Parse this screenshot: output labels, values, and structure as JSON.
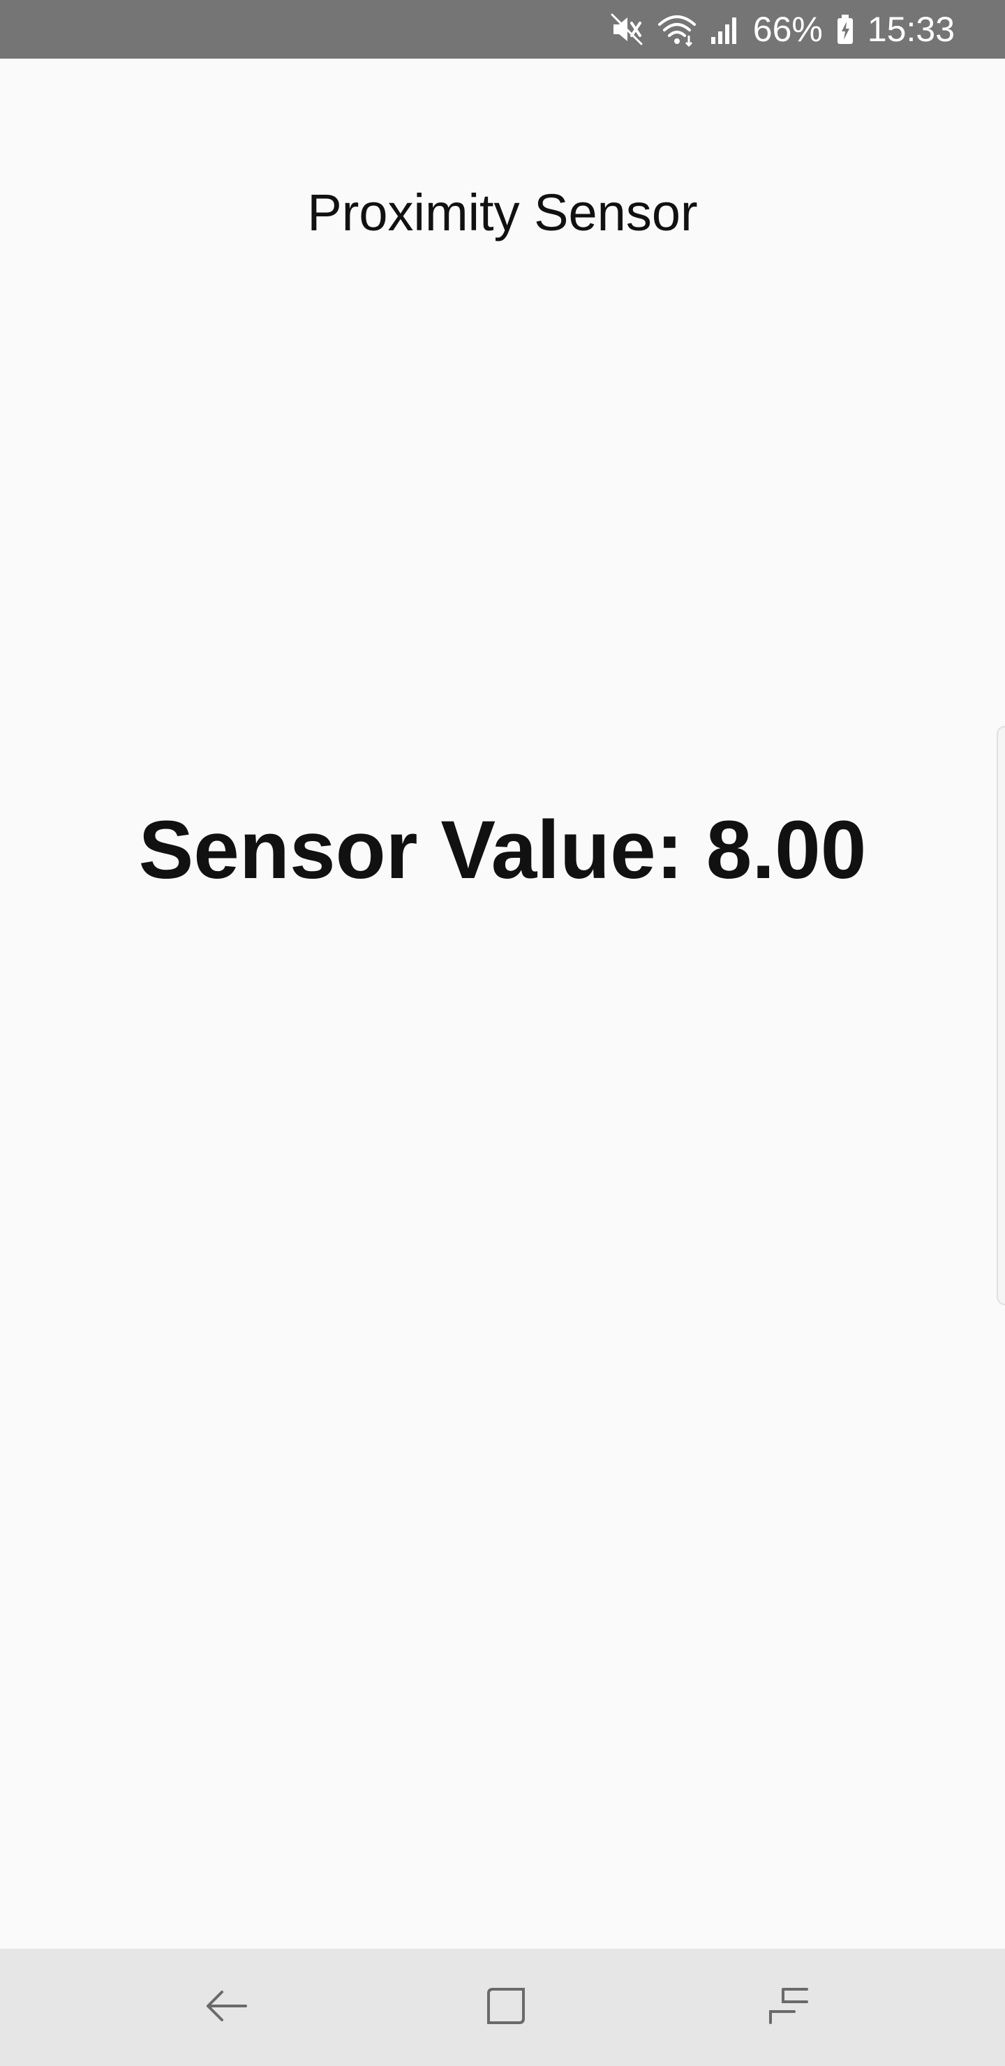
{
  "status_bar": {
    "battery_percent": "66%",
    "time": "15:33",
    "icons": [
      "mute-icon",
      "wifi-icon",
      "signal-icon",
      "battery-charging-icon"
    ]
  },
  "app": {
    "title": "Proximity Sensor",
    "sensor_value_text": "Sensor Value: 8.00"
  },
  "nav_bar": {
    "icons": [
      "back-icon",
      "home-icon",
      "recents-icon"
    ]
  },
  "colors": {
    "status_bar_bg": "#757575",
    "page_bg": "#fafafa",
    "nav_bar_bg": "#e6e6e6",
    "text": "#111111"
  }
}
